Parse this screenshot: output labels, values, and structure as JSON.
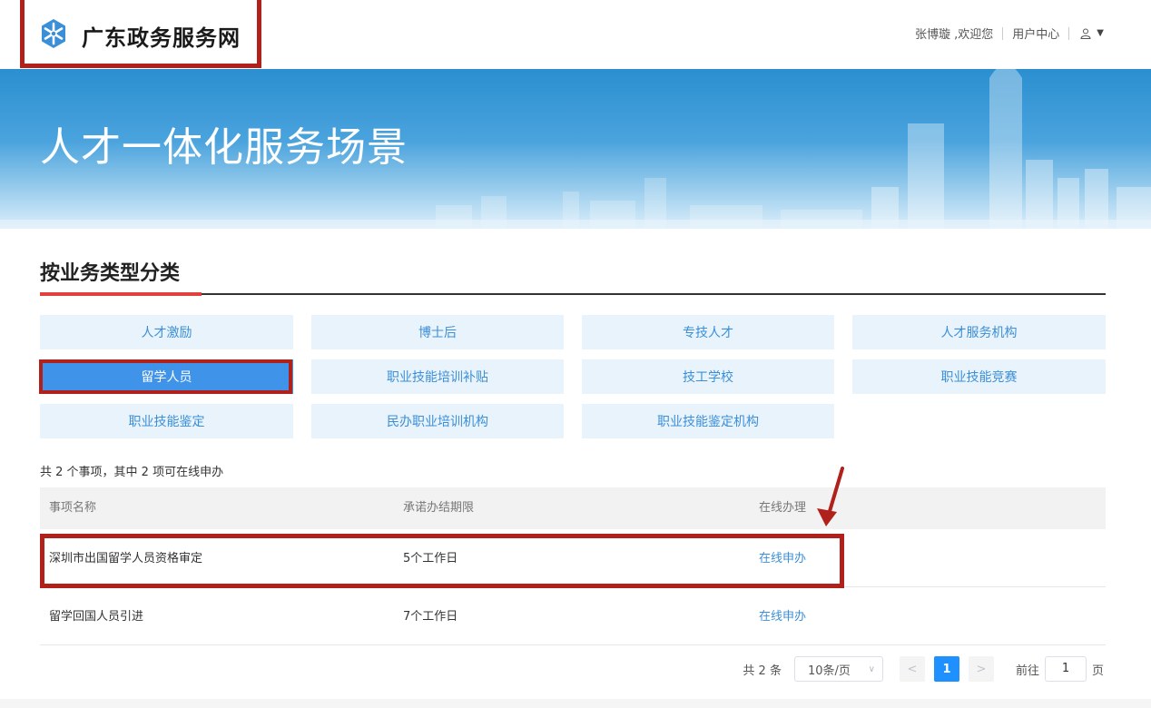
{
  "header": {
    "logo_text": "广东政务服务网",
    "user_greeting": "张博璇 ,欢迎您",
    "user_center": "用户中心"
  },
  "banner": {
    "title": "人才一体化服务场景"
  },
  "section": {
    "title": "按业务类型分类"
  },
  "categories": [
    {
      "label": "人才激励",
      "active": false
    },
    {
      "label": "博士后",
      "active": false
    },
    {
      "label": "专技人才",
      "active": false
    },
    {
      "label": "人才服务机构",
      "active": false
    },
    {
      "label": "留学人员",
      "active": true
    },
    {
      "label": "职业技能培训补贴",
      "active": false
    },
    {
      "label": "技工学校",
      "active": false
    },
    {
      "label": "职业技能竞赛",
      "active": false
    },
    {
      "label": "职业技能鉴定",
      "active": false
    },
    {
      "label": "民办职业培训机构",
      "active": false
    },
    {
      "label": "职业技能鉴定机构",
      "active": false
    }
  ],
  "summary": "共 2 个事项，其中 2 项可在线申办",
  "table": {
    "headers": [
      "事项名称",
      "承诺办结期限",
      "在线办理"
    ],
    "rows": [
      {
        "name": "深圳市出国留学人员资格审定",
        "deadline": "5个工作日",
        "action": "在线申办"
      },
      {
        "name": "留学回国人员引进",
        "deadline": "7个工作日",
        "action": "在线申办"
      }
    ]
  },
  "pagination": {
    "total": "共 2 条",
    "page_size": "10条/页",
    "prev": "<",
    "current": "1",
    "next": ">",
    "goto_label": "前往",
    "goto_value": "1",
    "goto_suffix": "页"
  },
  "colors": {
    "accent_red": "#b0211c",
    "link_blue": "#3c8fd6",
    "active_blue": "#3f93e8"
  }
}
